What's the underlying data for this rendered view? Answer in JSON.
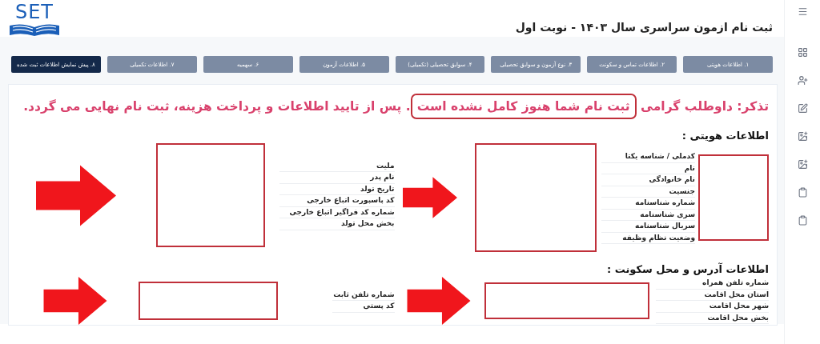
{
  "header": {
    "logo": "SET",
    "title": "ثبت نام ازمون سراسری سال ۱۴۰۳ - نوبت اول"
  },
  "steps": [
    {
      "label": "۱. اطلاعات هویتی",
      "selected": false
    },
    {
      "label": "۲. اطلاعات تماس و سکونت",
      "selected": false
    },
    {
      "label": "۳. نوع آزمون و سوابق تحصیلی",
      "selected": false
    },
    {
      "label": "۴. سوابق تحصیلی (تکمیلی)",
      "selected": false
    },
    {
      "label": "۵. اطلاعات آزمون",
      "selected": false
    },
    {
      "label": "۶. سهمیه",
      "selected": false
    },
    {
      "label": "۷. اطلاعات تکمیلی",
      "selected": false
    },
    {
      "label": "۸. پیش نمایش اطلاعات ثبت شده",
      "selected": true
    }
  ],
  "notice": {
    "before": "تذکر: داوطلب گرامی",
    "highlight": "ثبت نام شما هنوز کامل نشده است",
    "after": ". پس از تایید اطلاعات و پرداخت هزینه، ثبت نام نهایی می گردد."
  },
  "sections": [
    {
      "heading": "اطلاعات هویتی :",
      "columns": [
        {
          "fields": [
            "کدملی / شناسه یکتا",
            "نام",
            "نام خانوادگی",
            "جنسیت",
            "شماره شناسنامه",
            "سری شناسنامه",
            "سریال شناسنامه",
            "وضعیت نظام وظیفه"
          ]
        },
        {
          "fields": [
            "ملیت",
            "نام پدر",
            "تاریخ تولد",
            "کد پاسپورت اتباع خارجی",
            "شماره کد فراگیر اتباع خارجی",
            "بخش محل تولد"
          ]
        }
      ]
    },
    {
      "heading": "اطلاعات آدرس و محل سکونت :",
      "columns": [
        {
          "fields": [
            "شماره تلفن همراه",
            "استان محل اقامت",
            "شهر محل اقامت",
            "بخش محل اقامت"
          ]
        },
        {
          "fields": [
            "شماره تلفن ثابت",
            "کد پستی"
          ]
        }
      ]
    }
  ]
}
